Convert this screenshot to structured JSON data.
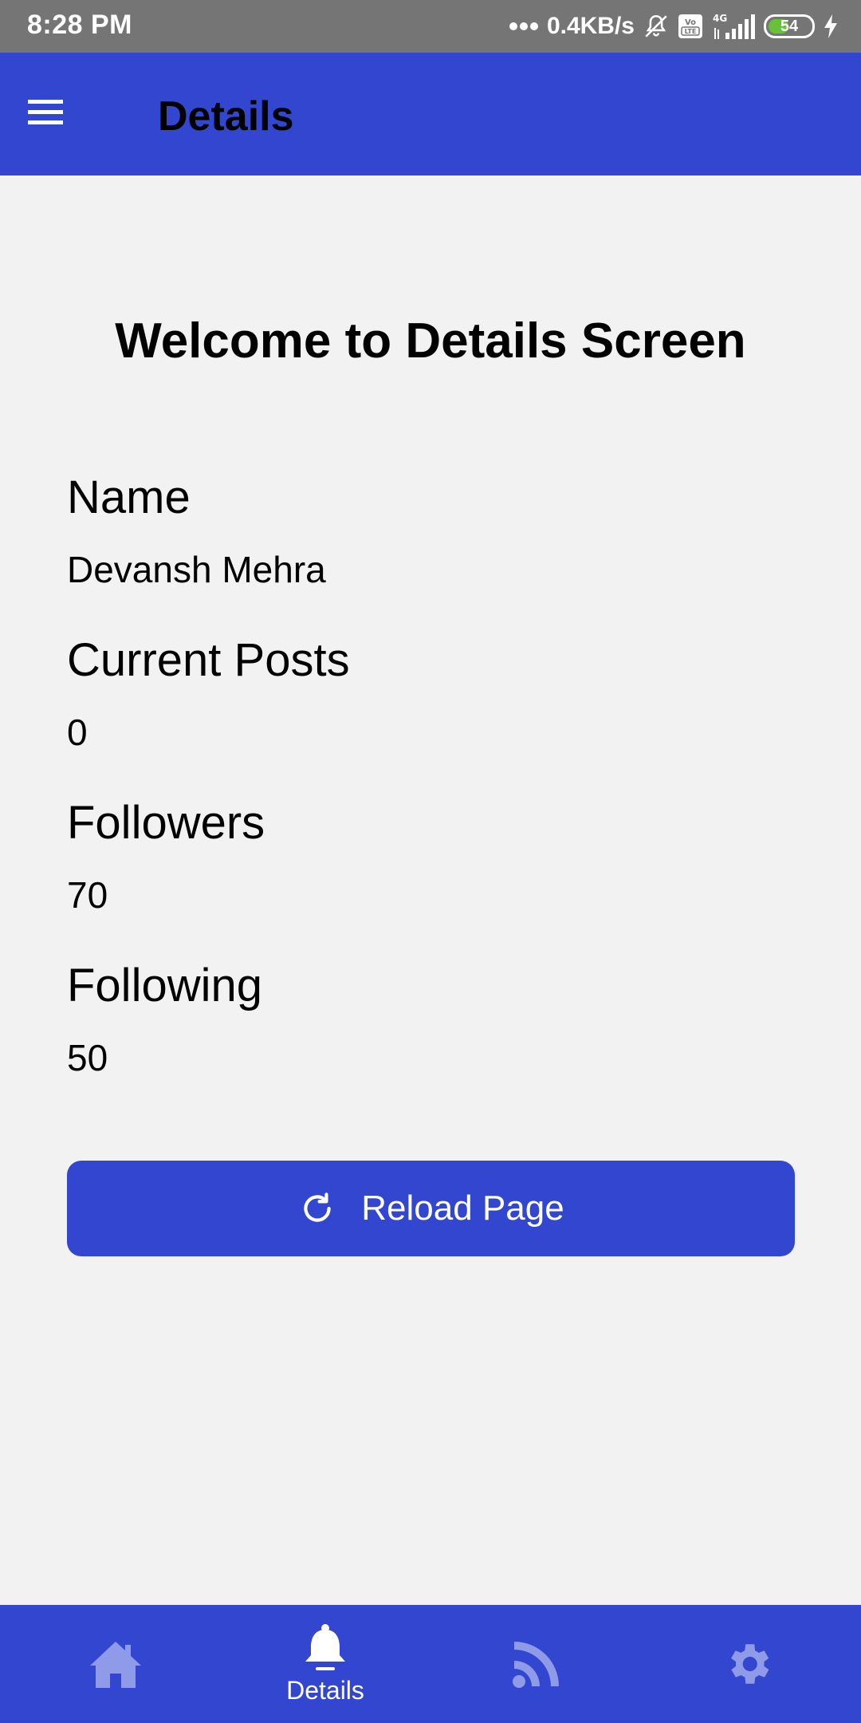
{
  "status_bar": {
    "time": "8:28 PM",
    "network_speed": "0.4KB/s",
    "network_type": "4G",
    "volte": "Vo LTE",
    "battery_level": "54",
    "battery_fraction": 0.54
  },
  "app_bar": {
    "title": "Details",
    "menu_icon": "hamburger-menu-icon"
  },
  "main": {
    "welcome": "Welcome to Details Screen",
    "fields": [
      {
        "label": "Name",
        "value": "Devansh Mehra"
      },
      {
        "label": "Current Posts",
        "value": "0"
      },
      {
        "label": "Followers",
        "value": "70"
      },
      {
        "label": "Following",
        "value": "50"
      }
    ],
    "reload_button": {
      "label": "Reload Page",
      "icon": "refresh-icon"
    }
  },
  "bottom_nav": {
    "items": [
      {
        "icon": "home-icon",
        "label": "",
        "active": false
      },
      {
        "icon": "bell-icon",
        "label": "Details",
        "active": true
      },
      {
        "icon": "rss-feed-icon",
        "label": "",
        "active": false
      },
      {
        "icon": "gear-icon",
        "label": "",
        "active": false
      }
    ]
  },
  "colors": {
    "primary": "#3246cf",
    "background": "#f2f2f2",
    "status_bar": "#757575",
    "inactive_icon": "#8f9be8",
    "battery_green": "#67c23a"
  }
}
